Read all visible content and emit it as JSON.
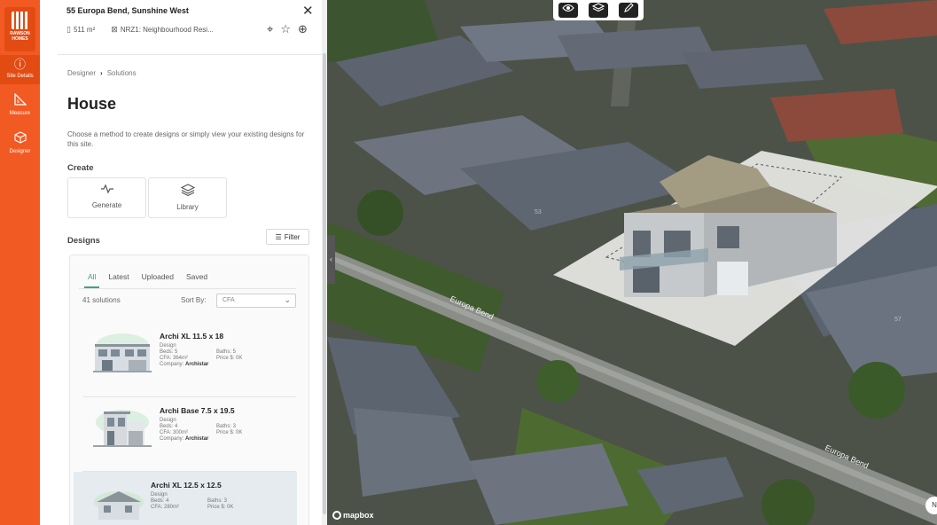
{
  "brand": {
    "name_line1": "RAWSON",
    "name_line2": "HOMES",
    "accent": "#f15a22"
  },
  "rail": {
    "items": [
      {
        "label": "Site Details",
        "icon": "info-circle-icon"
      },
      {
        "label": "Measure",
        "icon": "ruler-icon"
      },
      {
        "label": "Designer",
        "icon": "cube-icon"
      }
    ]
  },
  "header": {
    "address": "55 Europa Bend, Sunshine West",
    "area": "511 m²",
    "zoning": "NRZ1: Neighbourhood Resi..."
  },
  "breadcrumb": {
    "parent": "Designer",
    "current": "Solutions"
  },
  "page": {
    "title": "House",
    "description": "Choose a method to create designs or simply view your existing designs for this site."
  },
  "create": {
    "title": "Create",
    "generate_label": "Generate",
    "library_label": "Library"
  },
  "designs": {
    "title": "Designs",
    "filter_label": "Filter",
    "tabs": [
      "All",
      "Latest",
      "Uploaded",
      "Saved"
    ],
    "count": "41 solutions",
    "sort_label": "Sort By:",
    "sort_value": "CFA",
    "items": [
      {
        "name": "Archi XL 11.5 x 18",
        "type": "Design",
        "beds": "Beds: 5",
        "baths": "Baths: 5",
        "cfa": "CFA: 364m²",
        "price": "Price $: 0K",
        "company_label": "Company:",
        "company": "Archistar"
      },
      {
        "name": "Archi Base 7.5 x 19.5",
        "type": "Design",
        "beds": "Beds: 4",
        "baths": "Baths: 3",
        "cfa": "CFA: 300m²",
        "price": "Price $: 0K",
        "company_label": "Company:",
        "company": "Archistar"
      },
      {
        "name": "Archi XL 12.5 x 12.5",
        "type": "Design",
        "beds": "Beds: 4",
        "baths": "Baths: 3",
        "cfa": "CFA: 280m²",
        "price": "Price $: 0K",
        "company_label": "",
        "company": ""
      }
    ]
  },
  "map": {
    "road_label_1": "Europa Bend",
    "road_label_2": "Europa Bend",
    "lot_number_1": "53",
    "lot_number_2": "57",
    "attribution": "mapbox",
    "corner_label": "N"
  }
}
